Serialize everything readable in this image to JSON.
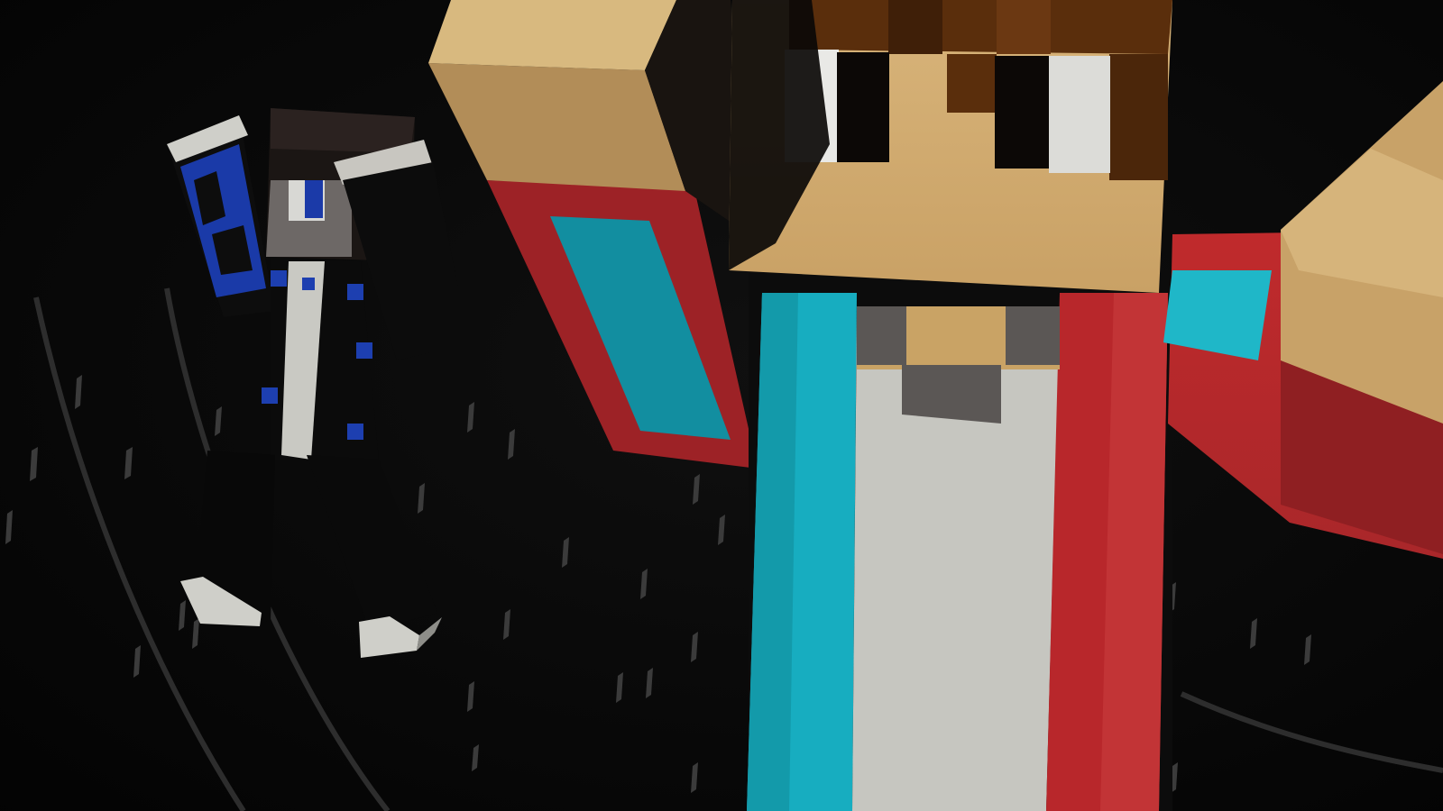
{
  "scene": {
    "title": "",
    "palette": {
      "background": "#050505",
      "skin_light": "#d9b77c",
      "skin_shadow": "#a88652",
      "hair_brown": "#5a2e0c",
      "jacket_red": "#b82428",
      "jacket_teal": "#18b1c3",
      "shirt_white": "#c9c9c2",
      "collar_gray": "#5b5755",
      "suit_black": "#0b0b0b",
      "suit_blue": "#1d3fb0"
    },
    "characters": [
      {
        "name": "",
        "icon": "blocky-character-red-teal-jacket"
      },
      {
        "name": "",
        "icon": "blocky-character-black-blue-suit"
      }
    ],
    "decor": {
      "icon": "falling-particles",
      "ring_icon": "curved-track"
    }
  }
}
